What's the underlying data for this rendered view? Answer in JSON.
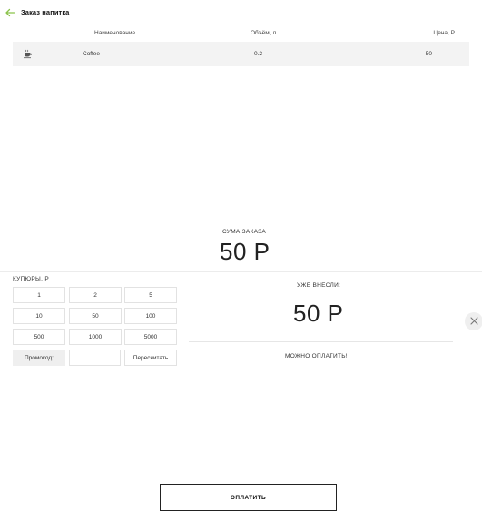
{
  "header": {
    "title": "Заказ напитка",
    "back_icon": "arrow-left-icon",
    "accent": "#8bc34a"
  },
  "table": {
    "columns": [
      "Наименование",
      "Объём, л",
      "Цена, Р"
    ],
    "rows": [
      {
        "icon": "coffee-cup-icon",
        "name": "Coffee",
        "volume": "0.2",
        "price": "50"
      }
    ]
  },
  "order_sum": {
    "label": "СУМА ЗАКАЗА",
    "value": "50 Р"
  },
  "bills": {
    "label": "КУПЮРЫ, Р",
    "values": [
      "1",
      "2",
      "5",
      "10",
      "50",
      "100",
      "500",
      "1000",
      "5000"
    ],
    "promo_label": "Промокод:",
    "promo_value": "",
    "recalc_label": "Пересчитать"
  },
  "paid": {
    "label": "УЖЕ ВНЕСЛИ:",
    "value": "50 Р",
    "status": "МОЖНО ОПЛАТИТЬ!"
  },
  "close_icon": "close-icon",
  "pay_button": {
    "label": "ОПЛАТИТЬ"
  }
}
